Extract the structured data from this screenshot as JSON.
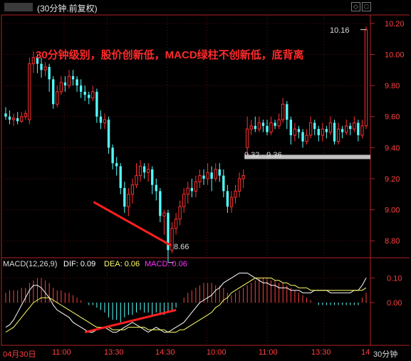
{
  "window": {
    "title": "(30分钟.前复权)",
    "controls": [
      "◇",
      "□"
    ]
  },
  "annotation": "30分钟级别，股价创新低，MACD绿柱不创新低，底背离",
  "price_labels": {
    "high": "10.16",
    "range": "9.32 - 9.36",
    "low": "8.66"
  },
  "indicator": {
    "name": "MACD(12,26,9)",
    "dif_label": "DIF: 0.09",
    "dea_label": "DEA: 0.06",
    "macd_label": "MACD: 0.06"
  },
  "period_label": "30分钟",
  "chart_data": {
    "type": "candlestick",
    "price_axis": {
      "ticks": [
        "10.20",
        "10.00",
        "9.80",
        "9.60",
        "9.40",
        "9.20",
        "9.00",
        "8.80"
      ],
      "range": [
        8.7,
        10.25
      ]
    },
    "macd_axis": {
      "ticks": [
        "0.10",
        "0.00"
      ],
      "range": [
        -0.13,
        0.13
      ]
    },
    "time_ticks": [
      "04月30日",
      "11:00",
      "13:30",
      "14:30",
      "10:00",
      "11:00",
      "13:30",
      "14"
    ],
    "candles": [
      [
        9.62,
        9.6,
        9.66,
        9.58
      ],
      [
        9.6,
        9.58,
        9.64,
        9.55
      ],
      [
        9.58,
        9.59,
        9.62,
        9.54
      ],
      [
        9.59,
        9.57,
        9.63,
        9.55
      ],
      [
        9.57,
        9.6,
        9.63,
        9.56
      ],
      [
        9.6,
        9.62,
        9.64,
        9.58
      ],
      [
        9.58,
        9.94,
        9.98,
        9.55
      ],
      [
        9.94,
        9.98,
        10.02,
        9.88
      ],
      [
        9.98,
        9.94,
        10.0,
        9.88
      ],
      [
        9.94,
        9.9,
        9.98,
        9.85
      ],
      [
        9.9,
        9.92,
        9.95,
        9.86
      ],
      [
        9.92,
        9.84,
        9.94,
        9.76
      ],
      [
        9.84,
        9.68,
        9.86,
        9.65
      ],
      [
        9.68,
        9.76,
        9.8,
        9.66
      ],
      [
        9.76,
        9.82,
        9.86,
        9.74
      ],
      [
        9.82,
        9.8,
        9.86,
        9.76
      ],
      [
        9.8,
        9.86,
        9.9,
        9.78
      ],
      [
        9.86,
        9.84,
        9.9,
        9.8
      ],
      [
        9.84,
        9.8,
        9.86,
        9.76
      ],
      [
        9.8,
        9.76,
        9.84,
        9.72
      ],
      [
        9.76,
        9.74,
        9.8,
        9.7
      ],
      [
        9.74,
        9.72,
        9.76,
        9.68
      ],
      [
        9.72,
        9.76,
        9.8,
        9.7
      ],
      [
        9.76,
        9.6,
        9.78,
        9.56
      ],
      [
        9.6,
        9.56,
        9.64,
        9.52
      ],
      [
        9.56,
        9.58,
        9.62,
        9.52
      ],
      [
        9.58,
        9.4,
        9.6,
        9.36
      ],
      [
        9.4,
        9.3,
        9.42,
        9.26
      ],
      [
        9.3,
        9.28,
        9.34,
        9.22
      ],
      [
        9.28,
        9.14,
        9.3,
        9.1
      ],
      [
        9.14,
        9.02,
        9.18,
        8.98
      ],
      [
        9.02,
        9.1,
        9.14,
        8.96
      ],
      [
        9.1,
        9.16,
        9.2,
        9.04
      ],
      [
        9.16,
        9.22,
        9.3,
        9.14
      ],
      [
        9.22,
        9.28,
        9.32,
        9.18
      ],
      [
        9.28,
        9.24,
        9.3,
        9.2
      ],
      [
        9.24,
        9.26,
        9.3,
        9.18
      ],
      [
        9.26,
        9.16,
        9.28,
        9.1
      ],
      [
        9.16,
        9.12,
        9.2,
        9.06
      ],
      [
        9.12,
        8.96,
        9.14,
        8.92
      ],
      [
        8.96,
        8.98,
        9.0,
        8.84
      ],
      [
        8.98,
        8.74,
        9.0,
        8.66
      ],
      [
        8.74,
        8.88,
        8.92,
        8.72
      ],
      [
        8.88,
        8.94,
        8.98,
        8.84
      ],
      [
        8.94,
        9.02,
        9.06,
        8.9
      ],
      [
        9.02,
        9.1,
        9.14,
        8.98
      ],
      [
        9.1,
        9.14,
        9.18,
        9.04
      ],
      [
        9.14,
        9.12,
        9.2,
        9.08
      ],
      [
        9.12,
        9.18,
        9.22,
        9.08
      ],
      [
        9.18,
        9.22,
        9.26,
        9.14
      ],
      [
        9.22,
        9.2,
        9.26,
        9.16
      ],
      [
        9.2,
        9.24,
        9.3,
        9.16
      ],
      [
        9.24,
        9.2,
        9.28,
        9.12
      ],
      [
        9.2,
        9.26,
        9.3,
        9.18
      ],
      [
        9.26,
        9.22,
        9.3,
        9.18
      ],
      [
        9.22,
        9.12,
        9.26,
        9.08
      ],
      [
        9.12,
        9.02,
        9.16,
        8.98
      ],
      [
        9.02,
        9.08,
        9.12,
        8.98
      ],
      [
        9.08,
        9.12,
        9.16,
        9.04
      ],
      [
        9.12,
        9.2,
        9.24,
        9.08
      ],
      [
        9.2,
        9.22,
        9.26,
        9.14
      ],
      [
        9.4,
        9.52,
        9.6,
        9.34
      ],
      [
        9.52,
        9.54,
        9.58,
        9.48
      ],
      [
        9.54,
        9.52,
        9.6,
        9.5
      ],
      [
        9.52,
        9.56,
        9.6,
        9.5
      ],
      [
        9.56,
        9.54,
        9.58,
        9.5
      ],
      [
        9.54,
        9.5,
        9.58,
        9.48
      ],
      [
        9.5,
        9.56,
        9.6,
        9.48
      ],
      [
        9.56,
        9.54,
        9.58,
        9.52
      ],
      [
        9.54,
        9.58,
        9.62,
        9.52
      ],
      [
        9.58,
        9.68,
        9.72,
        9.56
      ],
      [
        9.68,
        9.58,
        9.7,
        9.52
      ],
      [
        9.58,
        9.48,
        9.6,
        9.42
      ],
      [
        9.48,
        9.52,
        9.56,
        9.44
      ],
      [
        9.52,
        9.5,
        9.54,
        9.46
      ],
      [
        9.5,
        9.44,
        9.52,
        9.4
      ],
      [
        9.44,
        9.48,
        9.52,
        9.42
      ],
      [
        9.48,
        9.56,
        9.6,
        9.46
      ],
      [
        9.56,
        9.52,
        9.58,
        9.48
      ],
      [
        9.52,
        9.48,
        9.54,
        9.44
      ],
      [
        9.48,
        9.52,
        9.56,
        9.44
      ],
      [
        9.52,
        9.5,
        9.54,
        9.46
      ],
      [
        9.5,
        9.56,
        9.6,
        9.48
      ],
      [
        9.56,
        9.44,
        9.58,
        9.42
      ],
      [
        9.44,
        9.52,
        9.56,
        9.42
      ],
      [
        9.52,
        9.5,
        9.54,
        9.46
      ],
      [
        9.5,
        9.54,
        9.58,
        9.48
      ],
      [
        9.54,
        9.52,
        9.56,
        9.48
      ],
      [
        9.52,
        9.56,
        9.6,
        9.5
      ],
      [
        9.56,
        9.48,
        9.58,
        9.44
      ],
      [
        9.48,
        9.54,
        9.58,
        9.46
      ],
      [
        9.54,
        10.16,
        10.18,
        9.52
      ]
    ],
    "macd_hist": [
      0.04,
      0.05,
      0.05,
      0.05,
      0.06,
      0.06,
      0.08,
      0.09,
      0.1,
      0.1,
      0.09,
      0.08,
      0.06,
      0.05,
      0.05,
      0.04,
      0.04,
      0.03,
      0.02,
      0.01,
      0.0,
      -0.01,
      -0.01,
      -0.02,
      -0.03,
      -0.04,
      -0.06,
      -0.07,
      -0.07,
      -0.08,
      -0.06,
      -0.05,
      -0.05,
      -0.04,
      -0.03,
      -0.04,
      -0.04,
      -0.05,
      -0.04,
      -0.05,
      -0.05,
      -0.04,
      -0.03,
      -0.02,
      0.0,
      0.02,
      0.04,
      0.05,
      0.06,
      0.07,
      0.08,
      0.08,
      0.08,
      0.07,
      0.07,
      0.06,
      0.04,
      0.03,
      0.04,
      0.05,
      0.06,
      0.07,
      0.08,
      0.09,
      0.1,
      0.1,
      0.1,
      0.09,
      0.09,
      0.08,
      0.08,
      0.07,
      0.06,
      0.05,
      0.04,
      0.03,
      0.02,
      0.01,
      0.0,
      -0.01,
      -0.01,
      -0.01,
      -0.01,
      -0.01,
      -0.01,
      -0.01,
      -0.01,
      -0.01,
      -0.01,
      -0.01,
      0.02,
      0.04
    ],
    "series": [
      {
        "name": "DIF",
        "color": "#ffffff",
        "values": [
          -0.1,
          -0.09,
          -0.07,
          -0.04,
          -0.01,
          0.02,
          0.05,
          0.07,
          0.07,
          0.06,
          0.04,
          0.02,
          -0.01,
          -0.03,
          -0.04,
          -0.05,
          -0.06,
          -0.08,
          -0.09,
          -0.1,
          -0.11,
          -0.12,
          -0.12,
          -0.11,
          -0.1,
          -0.1,
          -0.11,
          -0.12,
          -0.12,
          -0.11,
          -0.1,
          -0.09,
          -0.08,
          -0.09,
          -0.1,
          -0.11,
          -0.12,
          -0.11,
          -0.1,
          -0.11,
          -0.12,
          -0.12,
          -0.11,
          -0.1,
          -0.09,
          -0.08,
          -0.06,
          -0.04,
          -0.02,
          0.0,
          0.01,
          0.02,
          0.03,
          0.05,
          0.06,
          0.08,
          0.09,
          0.1,
          0.11,
          0.12,
          0.12,
          0.12,
          0.11,
          0.1,
          0.09,
          0.08,
          0.08,
          0.07,
          0.07,
          0.06,
          0.06,
          0.06,
          0.05,
          0.05,
          0.05,
          0.04,
          0.04,
          0.04,
          0.05,
          0.05,
          0.05,
          0.05,
          0.04,
          0.04,
          0.04,
          0.04,
          0.04,
          0.04,
          0.05,
          0.05,
          0.07,
          0.1
        ]
      },
      {
        "name": "DEA",
        "color": "#ffff66",
        "values": [
          -0.12,
          -0.11,
          -0.1,
          -0.08,
          -0.06,
          -0.04,
          -0.02,
          0.0,
          0.01,
          0.02,
          0.02,
          0.02,
          0.01,
          0.0,
          -0.01,
          -0.02,
          -0.03,
          -0.04,
          -0.05,
          -0.06,
          -0.07,
          -0.08,
          -0.09,
          -0.1,
          -0.1,
          -0.1,
          -0.1,
          -0.11,
          -0.11,
          -0.11,
          -0.11,
          -0.1,
          -0.1,
          -0.1,
          -0.1,
          -0.1,
          -0.11,
          -0.11,
          -0.11,
          -0.11,
          -0.11,
          -0.12,
          -0.12,
          -0.12,
          -0.11,
          -0.11,
          -0.1,
          -0.09,
          -0.08,
          -0.07,
          -0.06,
          -0.05,
          -0.04,
          -0.02,
          -0.01,
          0.01,
          0.02,
          0.04,
          0.05,
          0.06,
          0.07,
          0.08,
          0.09,
          0.1,
          0.1,
          0.1,
          0.1,
          0.1,
          0.09,
          0.09,
          0.08,
          0.08,
          0.07,
          0.07,
          0.06,
          0.06,
          0.06,
          0.05,
          0.05,
          0.05,
          0.05,
          0.05,
          0.05,
          0.05,
          0.05,
          0.05,
          0.05,
          0.05,
          0.05,
          0.05,
          0.05,
          0.06
        ]
      }
    ],
    "annotations": {
      "price_trend_line": {
        "from": [
          24,
          9.05
        ],
        "to": [
          41,
          8.77
        ]
      },
      "macd_trend_line": {
        "from": [
          20,
          -0.12
        ],
        "to": [
          43,
          -0.03
        ]
      },
      "resistance_band": {
        "from_index": 61,
        "to_index": 91,
        "price": 9.34,
        "label": "9.32 - 9.36"
      }
    }
  }
}
